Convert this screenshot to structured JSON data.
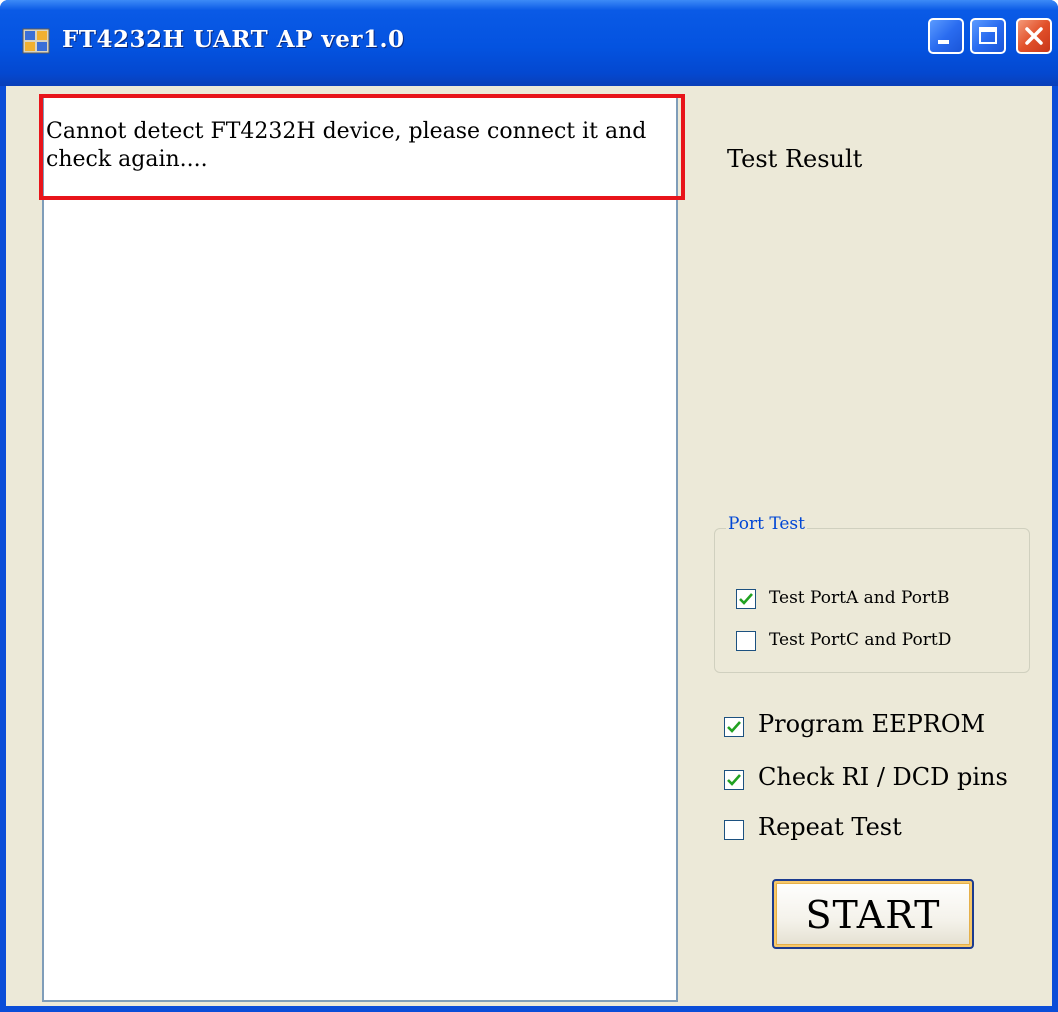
{
  "window": {
    "title": "FT4232H UART AP ver1.0"
  },
  "log": {
    "message": "Cannot detect FT4232H device, please connect it and check again...."
  },
  "test_result": {
    "label": "Test Result"
  },
  "port_test": {
    "legend": "Port Test",
    "options": [
      {
        "label": "Test PortA and PortB",
        "checked": true
      },
      {
        "label": "Test PortC and PortD",
        "checked": false
      }
    ]
  },
  "options": [
    {
      "label": "Program EEPROM",
      "checked": true
    },
    {
      "label": "Check RI / DCD pins",
      "checked": true
    },
    {
      "label": "Repeat Test",
      "checked": false
    }
  ],
  "start_button": {
    "label": "START"
  },
  "colors": {
    "titlebar": "#0453e0",
    "client": "#ece9d8",
    "highlight": "#e8141a",
    "legend": "#0046d5",
    "check": "#21a121"
  }
}
